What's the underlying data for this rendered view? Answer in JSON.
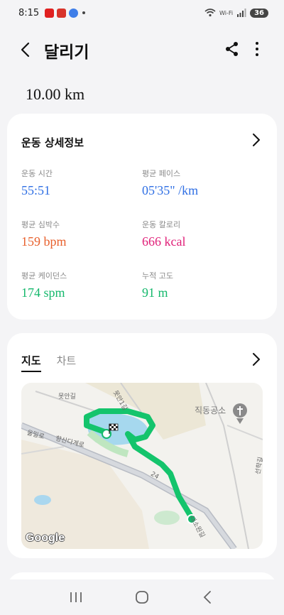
{
  "status_bar": {
    "time": "8:15",
    "battery": "36",
    "network_label": "Wi-Fi"
  },
  "header": {
    "title": "달리기"
  },
  "summary": {
    "distance": "10.00 km"
  },
  "details": {
    "title": "운동 상세정보",
    "stats": [
      {
        "label": "운동 시간",
        "value": "55:51",
        "color": "#2f6fe4"
      },
      {
        "label": "평균 페이스",
        "value": "05'35\" /km",
        "color": "#2f6fe4"
      },
      {
        "label": "평균 심박수",
        "value": "159 bpm",
        "color": "#e8602c"
      },
      {
        "label": "운동 칼로리",
        "value": "666 kcal",
        "color": "#e01f78"
      },
      {
        "label": "평균 케이던스",
        "value": "174 spm",
        "color": "#14b86c"
      },
      {
        "label": "누적 고도",
        "value": "91 m",
        "color": "#14b86c"
      }
    ]
  },
  "map_card": {
    "tabs": [
      {
        "label": "지도",
        "active": true
      },
      {
        "label": "차트",
        "active": false
      }
    ],
    "map": {
      "labels": [
        "못안길",
        "못안1길",
        "올밀로",
        "향산다계로",
        "직동공소",
        "선학길",
        "24",
        "대소원길"
      ],
      "provider": "Google"
    }
  }
}
